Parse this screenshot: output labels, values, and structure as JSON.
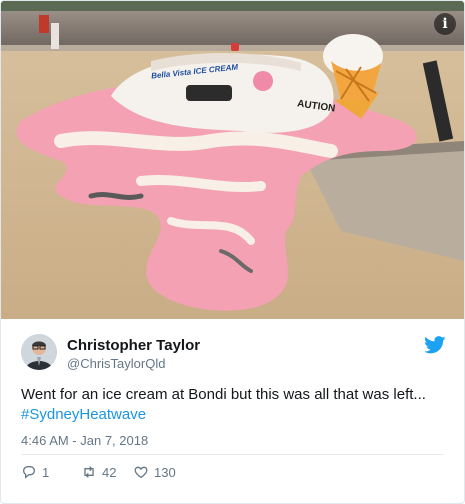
{
  "media": {
    "info_icon": "info-icon",
    "info_glyph": "i",
    "truck_sign": "Bella Vista ICE CREAM",
    "caution_sign": "AUTION"
  },
  "tweet": {
    "author_name": "Christopher Taylor",
    "author_handle": "@ChrisTaylorQld",
    "text": "Went for an ice cream at Bondi but this was all that was left...",
    "hashtag": "#SydneyHeatwave",
    "timestamp": "4:46 AM - Jan 7, 2018",
    "platform_icon": "twitter-bird-icon"
  },
  "actions": {
    "replies": "1",
    "retweets": "42",
    "likes": "130"
  },
  "colors": {
    "link": "#1b95e0",
    "secondary_text": "#657786",
    "primary_text": "#14171a",
    "twitter_blue": "#1da1f2"
  }
}
